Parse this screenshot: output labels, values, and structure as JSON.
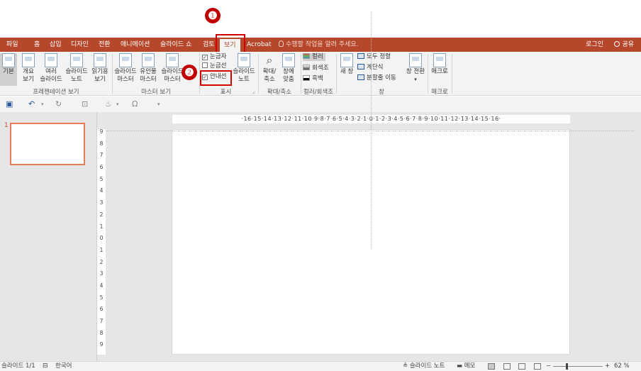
{
  "callouts": {
    "one": "❶",
    "two": "❷"
  },
  "tabs": {
    "file": "파일",
    "home": "홈",
    "insert": "삽입",
    "design": "디자인",
    "transitions": "전환",
    "animations": "애니메이션",
    "slideshow": "슬라이드 쇼",
    "review": "검토",
    "view": "보기",
    "acrobat": "Acrobat"
  },
  "tell_me": "수행할 작업을 알려 주세요.",
  "signin": "로그인",
  "share": "공유",
  "ribbon": {
    "pres_views": {
      "normal": "기본",
      "outline1": "개요",
      "outline2": "보기",
      "sorter1": "여러",
      "sorter2": "슬라이드",
      "notes1": "슬라이드",
      "notes2": "노트",
      "reading1": "읽기용",
      "reading2": "보기",
      "label": "프레젠테이션 보기"
    },
    "master_views": {
      "slide1": "슬라이드",
      "slide2": "마스터",
      "handout1": "유인물",
      "handout2": "마스터",
      "notes1": "슬라이드",
      "notes2": "마스터",
      "label": "마스터 보기"
    },
    "show": {
      "ruler": "눈금자",
      "gridlines": "눈금선",
      "guides": "안내선",
      "notes1": "슬라이드",
      "notes2": "노트",
      "label": "표시"
    },
    "zoom": {
      "zoom1": "확대/",
      "zoom2": "축소",
      "fit1": "창에",
      "fit2": "맞춤",
      "label": "확대/축소"
    },
    "color": {
      "color": "컬러",
      "gray": "회색조",
      "bw": "흑백",
      "label": "컬러/회색조"
    },
    "window": {
      "new": "새 창",
      "arrange": "모두 정렬",
      "cascade": "계단식",
      "split": "분할줄 이동",
      "switch": "창 전환",
      "label": "창"
    },
    "macros": {
      "macro": "매크로",
      "label": "매크로"
    }
  },
  "slide_number": "1",
  "hruler": "·16·15·14·13·12·11·10·9·8·7·6·5·4·3·2·1·0·1·2·3·4·5·6·7·8·9·10·11·12·13·14·15·16·",
  "vruler": [
    "9",
    "8",
    "7",
    "6",
    "5",
    "4",
    "3",
    "2",
    "1",
    "0",
    "1",
    "2",
    "3",
    "4",
    "5",
    "6",
    "7",
    "8",
    "9"
  ],
  "status": {
    "slide": "슬라이드 1/1",
    "lang": "한국어",
    "notes": "슬라이드 노트",
    "comments": "메모",
    "zoom": "62 %"
  }
}
